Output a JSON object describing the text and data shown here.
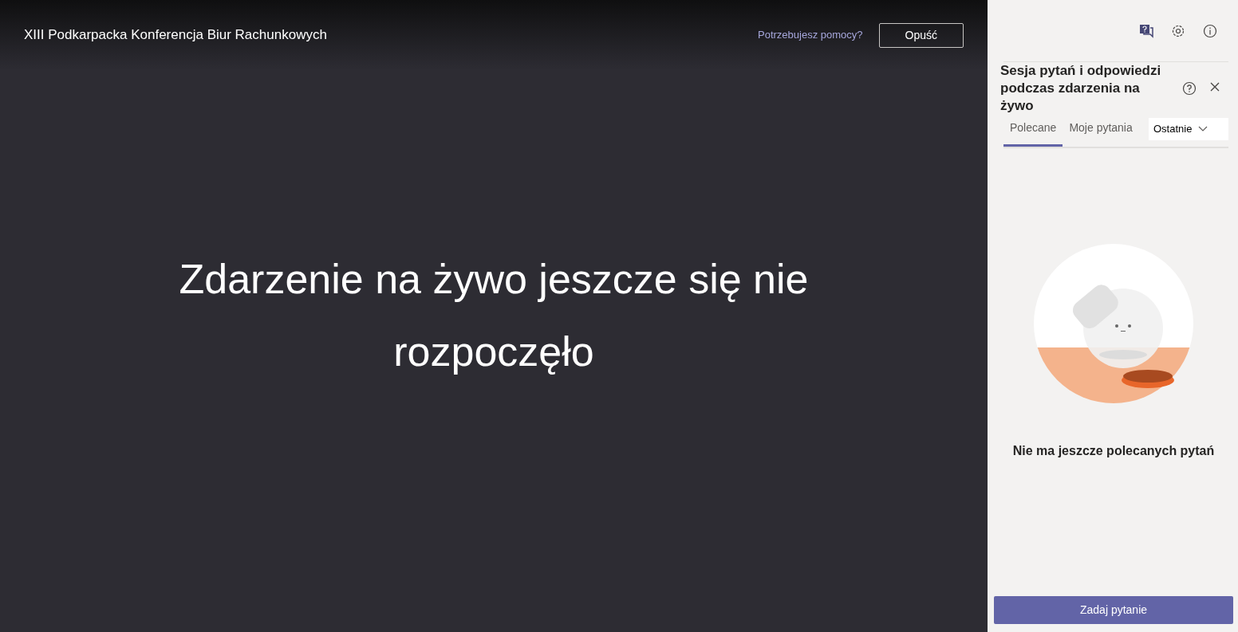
{
  "header": {
    "title": "XIII Podkarpacka Konferencja Biur Rachunkowych",
    "help_link": "Potrzebujesz pomocy?",
    "leave_button": "Opuść"
  },
  "stage": {
    "message": "Zdarzenie na żywo jeszcze się nie rozpoczęło"
  },
  "panel": {
    "title": "Sesja pytań i odpowiedzi podczas zdarzenia na żywo",
    "tabs": [
      {
        "label": "Polecane",
        "selected": true
      },
      {
        "label": "Moje pytania",
        "selected": false
      }
    ],
    "sort": {
      "value": "Ostatnie"
    },
    "empty_message": "Nie ma jeszcze polecanych pytań",
    "ask_button": "Zadaj pytanie"
  }
}
